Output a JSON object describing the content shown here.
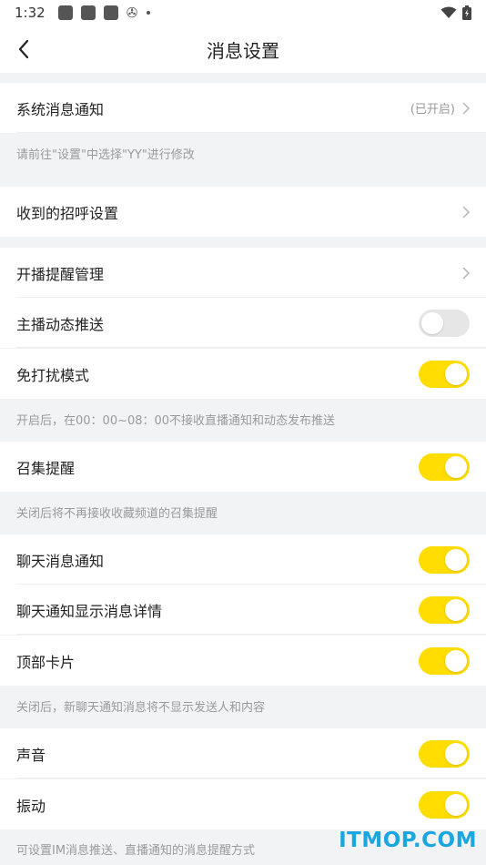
{
  "status_bar": {
    "time": "1:32"
  },
  "header": {
    "title": "消息设置"
  },
  "system_notify": {
    "label": "系统消息通知",
    "value": "(已开启)",
    "hint": "请前往\"设置\"中选择\"YY\"进行修改"
  },
  "greeting": {
    "label": "收到的招呼设置"
  },
  "live_remind": {
    "label": "开播提醒管理"
  },
  "anchor_push": {
    "label": "主播动态推送",
    "on": false
  },
  "dnd_mode": {
    "label": "免打扰模式",
    "on": true,
    "hint": "开启后，在00：00~08：00不接收直播通知和动态发布推送"
  },
  "gather_remind": {
    "label": "召集提醒",
    "on": true,
    "hint": "关闭后将不再接收收藏频道的召集提醒"
  },
  "chat_notify": {
    "label": "聊天消息通知",
    "on": true
  },
  "chat_detail": {
    "label": "聊天通知显示消息详情",
    "on": true
  },
  "top_card": {
    "label": "顶部卡片",
    "on": true,
    "hint": "关闭后，新聊天通知消息将不显示发送人和内容"
  },
  "sound": {
    "label": "声音",
    "on": true
  },
  "vibrate": {
    "label": "振动",
    "on": true,
    "hint": "可设置IM消息推送、直播通知的消息提醒方式"
  },
  "watermark": "ITMOP.COM",
  "colors": {
    "toggle_on": "#ffdd00",
    "toggle_off": "#e6e6e6",
    "background": "#f2f3f5"
  }
}
